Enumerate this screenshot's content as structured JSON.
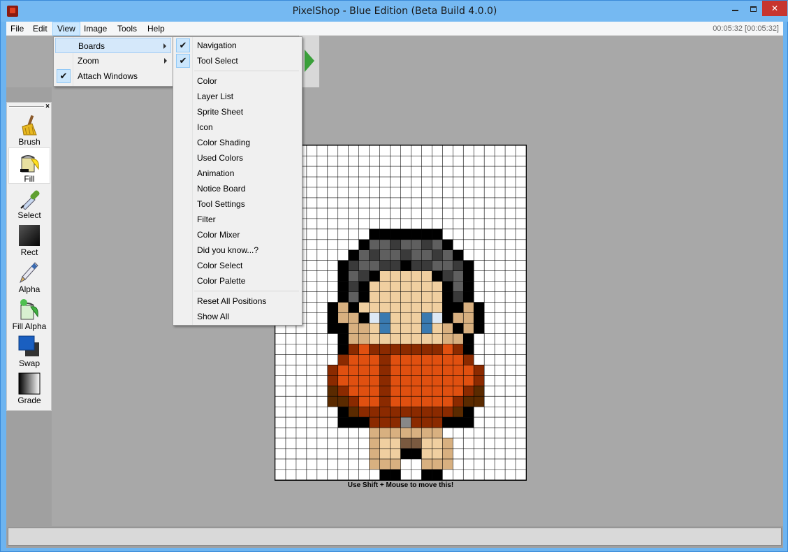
{
  "window": {
    "title": "PixelShop - Blue Edition (Beta Build 4.0.0)",
    "close_glyph": "✕"
  },
  "menubar": {
    "items": [
      "File",
      "Edit",
      "View",
      "Image",
      "Tools",
      "Help"
    ],
    "clock": "00:05:32 [00:05:32]"
  },
  "view_menu": {
    "items": [
      {
        "label": "Boards",
        "has_submenu": true,
        "checked": false
      },
      {
        "label": "Zoom",
        "has_submenu": true,
        "checked": false
      },
      {
        "label": "Attach Windows",
        "has_submenu": false,
        "checked": true
      }
    ]
  },
  "boards_menu": {
    "check_glyph": "✔",
    "items": [
      {
        "label": "Navigation",
        "checked": true
      },
      {
        "label": "Tool Select",
        "checked": true
      },
      {
        "label": "Color",
        "checked": false
      },
      {
        "label": "Layer List",
        "checked": false
      },
      {
        "label": "Sprite Sheet",
        "checked": false
      },
      {
        "label": "Icon",
        "checked": false
      },
      {
        "label": "Color Shading",
        "checked": false
      },
      {
        "label": "Used Colors",
        "checked": false
      },
      {
        "label": "Animation",
        "checked": false
      },
      {
        "label": "Notice Board",
        "checked": false
      },
      {
        "label": "Tool Settings",
        "checked": false
      },
      {
        "label": "Filter",
        "checked": false
      },
      {
        "label": "Color Mixer",
        "checked": false
      },
      {
        "label": "Did you know...?",
        "checked": false
      },
      {
        "label": "Color Select",
        "checked": false
      },
      {
        "label": "Color Palette",
        "checked": false
      },
      {
        "label": "Reset All Positions",
        "checked": false
      },
      {
        "label": "Show All",
        "checked": false
      }
    ]
  },
  "toolbox": {
    "close_glyph": "×",
    "tools": [
      {
        "label": "Brush",
        "icon": "brush-icon",
        "selected": false
      },
      {
        "label": "Fill",
        "icon": "fill-bucket-icon",
        "selected": true
      },
      {
        "label": "Select",
        "icon": "eyedropper-icon",
        "selected": false
      },
      {
        "label": "Rect",
        "icon": "rectangle-icon",
        "selected": false
      },
      {
        "label": "Alpha",
        "icon": "alpha-pen-icon",
        "selected": false
      },
      {
        "label": "Fill Alpha",
        "icon": "fill-alpha-icon",
        "selected": false
      },
      {
        "label": "Swap",
        "icon": "swap-colors-icon",
        "selected": false
      },
      {
        "label": "Grade",
        "icon": "gradient-icon",
        "selected": false
      }
    ]
  },
  "canvas": {
    "hint": "Use Shift + Mouse to move this!",
    "palette": {
      "K": "#000000",
      "D": "#3a3a3a",
      "G": "#5f5f5f",
      "S": "#f0cfa0",
      "T": "#d8b080",
      "B": "#3a7ab0",
      "W": "#dde8f5",
      "R": "#e05010",
      "M": "#8b2a00",
      "N": "#5a2a00",
      "H": "#888888",
      "P": "#7a5a40"
    },
    "rows": [
      "........................",
      "........................",
      "........................",
      "........................",
      "........................",
      "........................",
      "........................",
      "........................",
      ".........KKKKKKK........",
      "........KGGDGGDGK.......",
      ".......KGDGGDGGDGK......",
      "......KDGGDDKDDGGDK.....",
      "......KGDKSSSSSKDGK.....",
      "......KDKSSSSSSSKGK.....",
      "......KGKSSSSSSSKDK.....",
      ".....KTKSSSSSSSSKKTK....",
      ".....KTTKWBSSSBWKTTK....",
      ".....KKTTSBSSSBSTKTK....",
      "......KTTSSSSSSSTTK.....",
      "......KMRMMMMMMMRMK.....",
      "......MRRRMRRRRRRRM.....",
      ".....MRRRRMRRRRRRRRM....",
      ".....MRRRRMRRRRRRRRM....",
      ".....NMRRRMRRRRRRRMN....",
      ".....NNMRRMRRRRRRMNN....",
      "......KNMMMMMMMMMNK.....",
      "......KKKMMMHMMMKKK.....",
      ".........TTTTTTT........",
      ".........TSSPPSST.......",
      ".........TSSKKSST.......",
      ".........TTT..TTT.......",
      "..........KK..KK........"
    ]
  }
}
